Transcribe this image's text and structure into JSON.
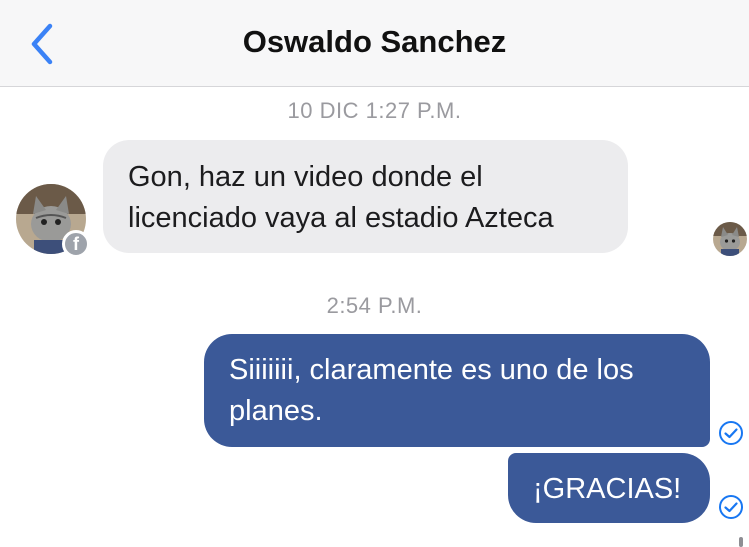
{
  "header": {
    "title": "Oswaldo Sanchez",
    "back_icon": "chevron-left-icon",
    "accent_color": "#3b82f6"
  },
  "messages": [
    {
      "type": "timestamp",
      "text": "10 DIC 1:27 P.M."
    },
    {
      "type": "incoming",
      "text": "Gon, haz un video donde el\nlicenciado vaya al estadio Azteca",
      "sender_badge_icon": "facebook-icon"
    },
    {
      "type": "timestamp",
      "text": "2:54 P.M."
    },
    {
      "type": "outgoing",
      "text": "Siiiiiii, claramente es uno de los\nplanes.",
      "status_icon": "check-circle-icon"
    },
    {
      "type": "outgoing",
      "text": "¡GRACIAS!",
      "status_icon": "check-circle-icon"
    }
  ],
  "colors": {
    "outgoing_bubble": "#3b5998",
    "incoming_bubble": "#ececee",
    "timestamp_text": "#9a9a9f",
    "read_check": "#1877f2"
  }
}
